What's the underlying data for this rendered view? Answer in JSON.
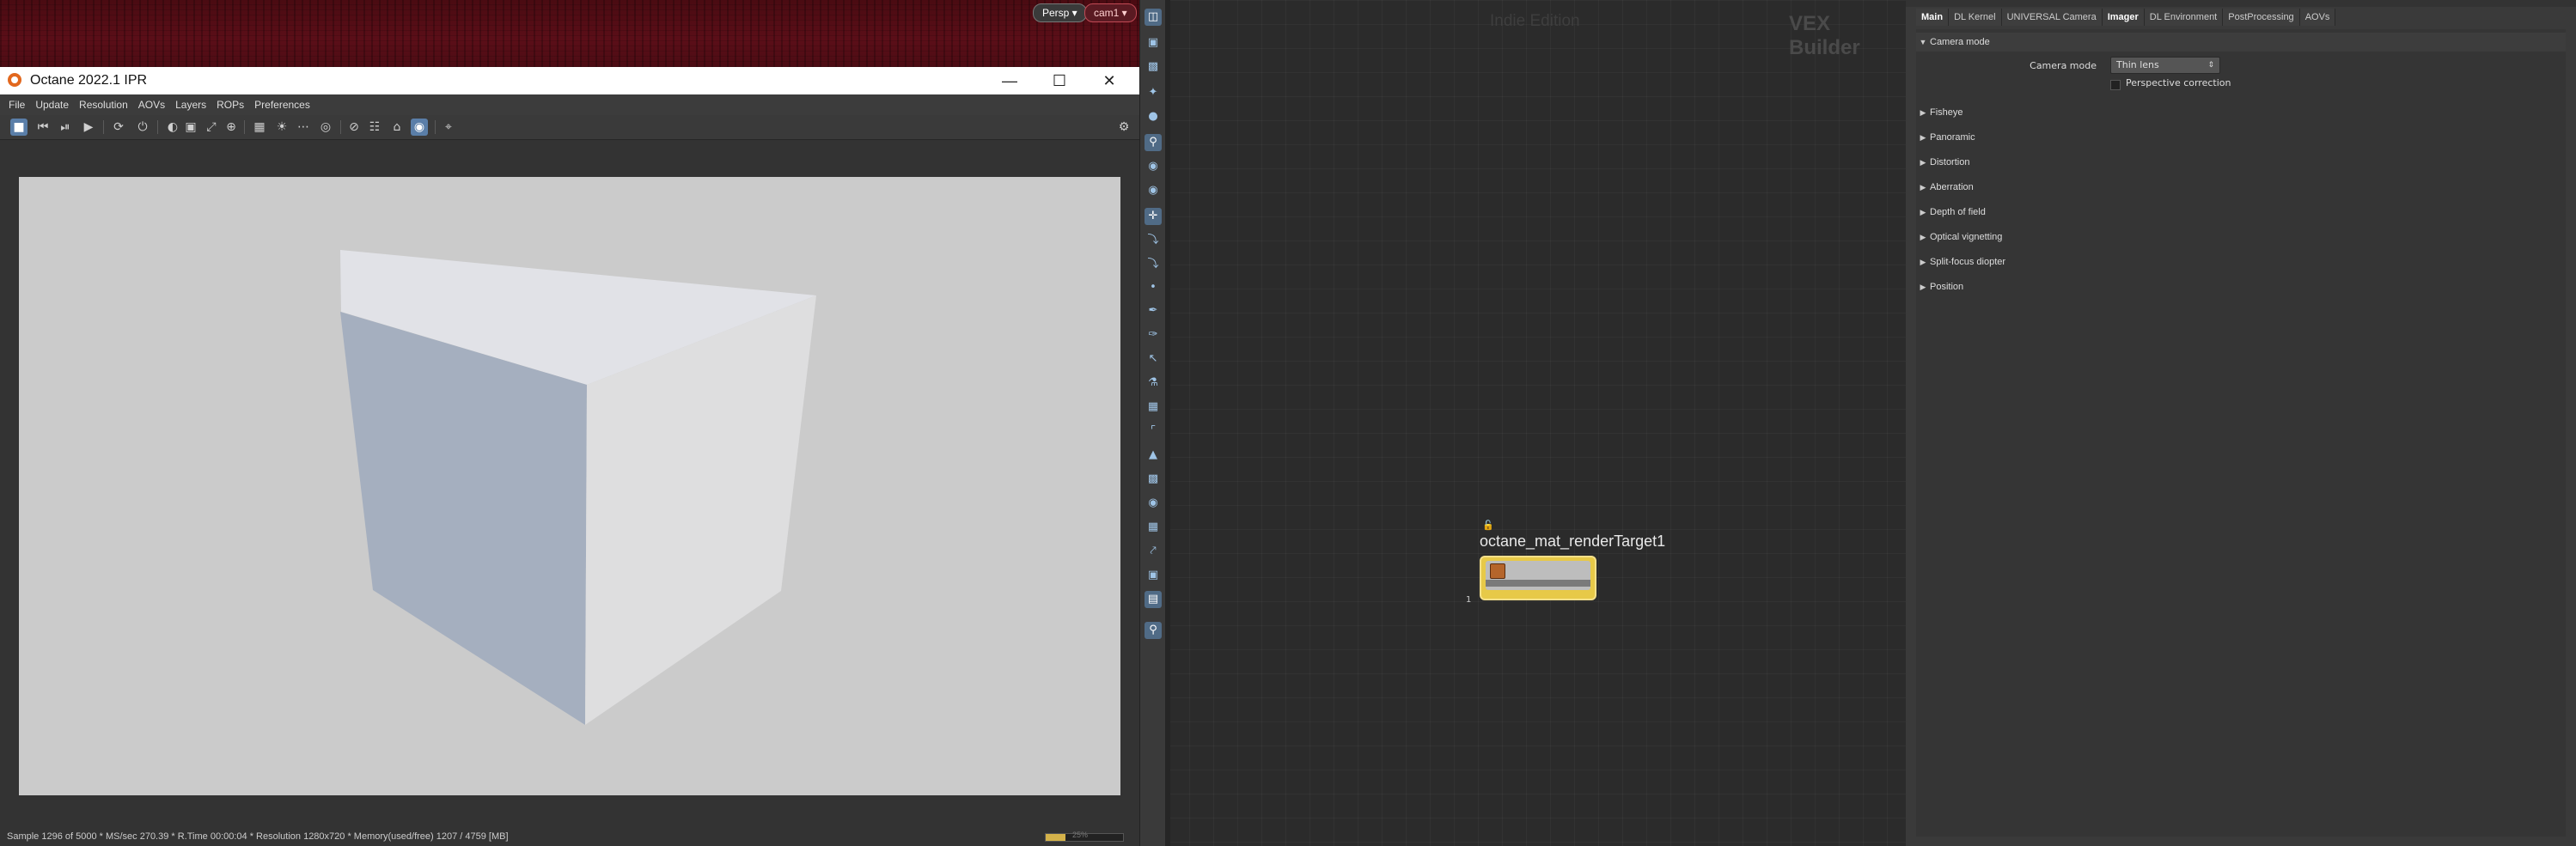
{
  "viewport": {
    "persp_label": "Persp ▾",
    "camera_label": "cam1 ▾"
  },
  "ipr": {
    "title": "Octane 2022.1 IPR",
    "window_controls": {
      "minimize": "—",
      "maximize": "☐",
      "close": "✕"
    },
    "menu": [
      "File",
      "Update",
      "Resolution",
      "AOVs",
      "Layers",
      "ROPs",
      "Preferences"
    ],
    "status": "Sample 1296 of 5000 * MS/sec 270.39 * R.Time 00:00:04 * Resolution 1280x720 * Memory(used/free) 1207 / 4759 [MB]",
    "progress_fraction": 0.26,
    "progress_label": "25%",
    "render_colors": {
      "background": "#cbcbcb",
      "cube_top": "#e1e2e7",
      "cube_left": "#a5afbf",
      "cube_right": "#dededf"
    }
  },
  "network": {
    "edition_label": "Indie Edition",
    "context_label": "VEX Builder",
    "node_name": "octane_mat_renderTarget1",
    "node_input_index": "1",
    "node_color": "#e7c948"
  },
  "params": {
    "tabs": [
      "Main",
      "DL Kernel",
      "UNIVERSAL Camera",
      "Imager",
      "DL Environment",
      "PostProcessing",
      "AOVs"
    ],
    "active_tabs": [
      "Main",
      "Imager"
    ],
    "camera_mode_folder": "Camera mode",
    "camera_mode_label": "Camera mode",
    "camera_mode_value": "Thin lens",
    "perspective_correction_label": "Perspective correction",
    "folders": [
      "Fisheye",
      "Panoramic",
      "Distortion",
      "Aberration",
      "Depth of field",
      "Optical vignetting",
      "Split-focus diopter",
      "Position"
    ]
  }
}
